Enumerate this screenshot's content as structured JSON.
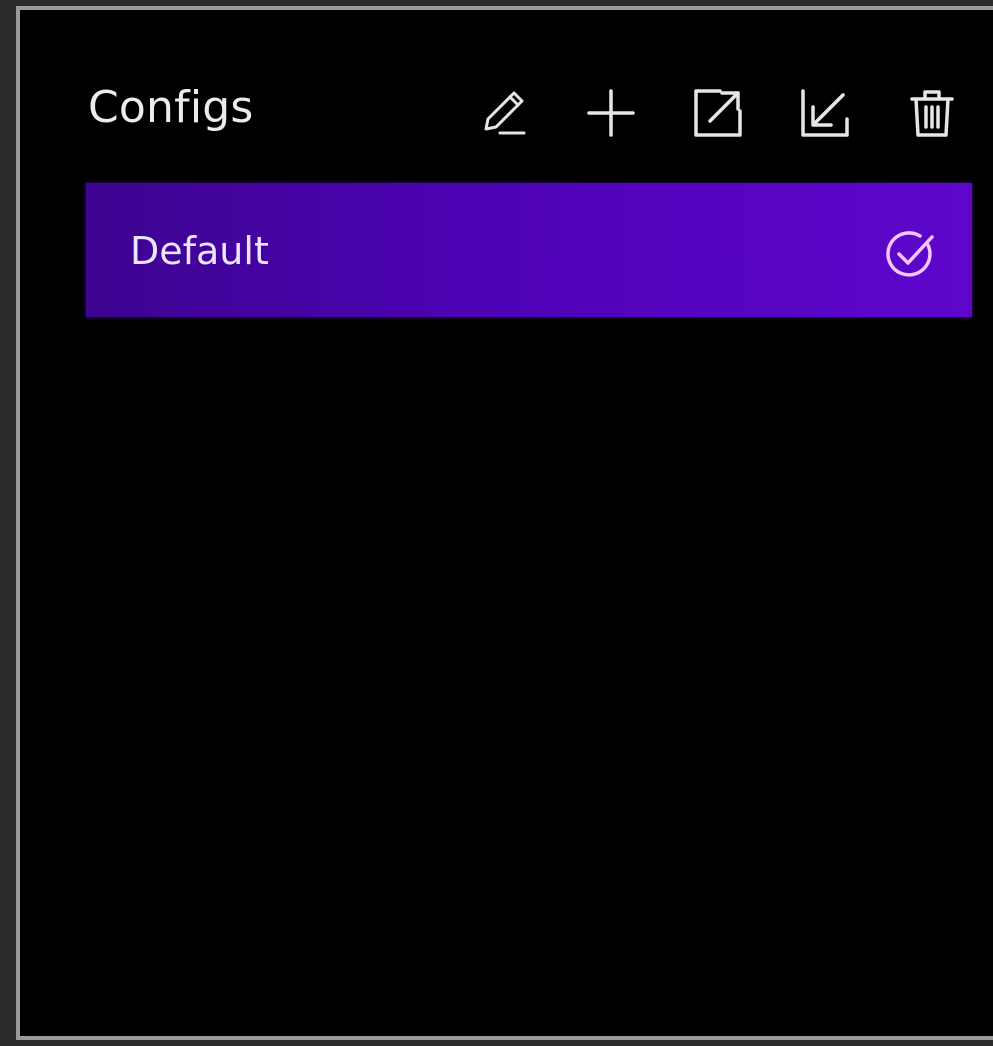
{
  "panel": {
    "title": "Configs"
  },
  "toolbar": {
    "buttons": [
      {
        "icon": "pencil-icon",
        "action": "edit"
      },
      {
        "icon": "plus-icon",
        "action": "add"
      },
      {
        "icon": "export-icon",
        "action": "export"
      },
      {
        "icon": "import-icon",
        "action": "import"
      },
      {
        "icon": "trash-icon",
        "action": "delete"
      }
    ]
  },
  "configs": [
    {
      "label": "Default",
      "active": true,
      "status_icon": "check-circle-icon"
    }
  ],
  "colors": {
    "background": "#000000",
    "frame_border": "#9a9a9a",
    "text": "#ececec",
    "selected_gradient_start": "#3c038f",
    "selected_gradient_end": "#5e06cc",
    "selected_text": "#ece3ff",
    "check_icon": "#f3c6ff"
  }
}
